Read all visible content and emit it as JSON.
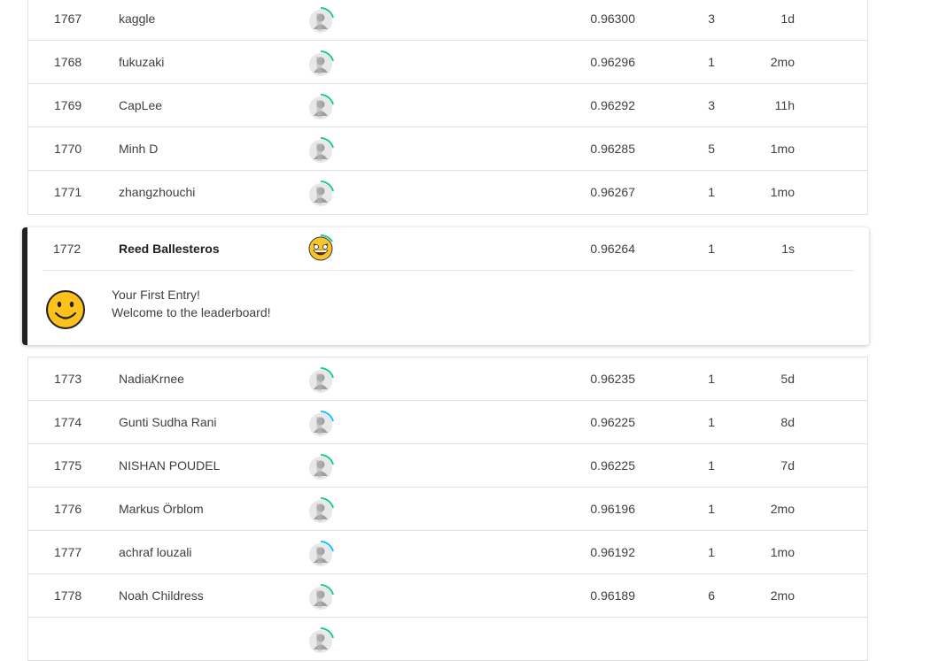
{
  "rows_before": [
    {
      "rank": "1767",
      "name": "kaggle",
      "score": "0.96300",
      "entries": "3",
      "last": "1d",
      "ring": "#20beff"
    },
    {
      "rank": "1768",
      "name": "fukuzaki",
      "score": "0.96296",
      "entries": "1",
      "last": "2mo",
      "ring": "#20beff"
    },
    {
      "rank": "1769",
      "name": "CapLee",
      "score": "0.96292",
      "entries": "3",
      "last": "11h",
      "ring": "#20beff"
    },
    {
      "rank": "1770",
      "name": "Minh D",
      "score": "0.96285",
      "entries": "5",
      "last": "1mo",
      "ring": "#20beff"
    },
    {
      "rank": "1771",
      "name": "zhangzhouchi",
      "score": "0.96267",
      "entries": "1",
      "last": "1mo",
      "ring": "#20beff"
    }
  ],
  "my_entry": {
    "rank": "1772",
    "name": "Reed Ballesteros",
    "score": "0.96264",
    "entries": "1",
    "last": "1s",
    "title": "Your First Entry!",
    "subtitle": "Welcome to the leaderboard!"
  },
  "rows_after": [
    {
      "rank": "1773",
      "name": "NadiaKrnee",
      "score": "0.96235",
      "entries": "1",
      "last": "5d",
      "ring": "#20beff"
    },
    {
      "rank": "1774",
      "name": "Gunti Sudha Rani",
      "score": "0.96225",
      "entries": "1",
      "last": "8d",
      "ring": "#20beff"
    },
    {
      "rank": "1775",
      "name": "NISHAN POUDEL",
      "score": "0.96225",
      "entries": "1",
      "last": "7d",
      "ring": "#20beff"
    },
    {
      "rank": "1776",
      "name": "Markus Örblom",
      "score": "0.96196",
      "entries": "1",
      "last": "2mo",
      "ring": "#20beff"
    },
    {
      "rank": "1777",
      "name": "achraf louzali",
      "score": "0.96192",
      "entries": "1",
      "last": "1mo",
      "ring": "#20beff"
    },
    {
      "rank": "1778",
      "name": "Noah Childress",
      "score": "0.96189",
      "entries": "6",
      "last": "2mo",
      "ring": "#20beff"
    },
    {
      "rank": "",
      "name": "",
      "score": "",
      "entries": "",
      "last": "",
      "ring": "#20beff"
    }
  ],
  "colors": {
    "ring_green": "#20c997",
    "ring_blue": "#20beff",
    "highlight_bar": "#202124",
    "border": "#e0e0e0"
  },
  "icons": {
    "user_avatar": "default-user-avatar-icon",
    "my_avatar": "laughing-face-avatar-icon",
    "smiley": "smiley-face-icon"
  }
}
